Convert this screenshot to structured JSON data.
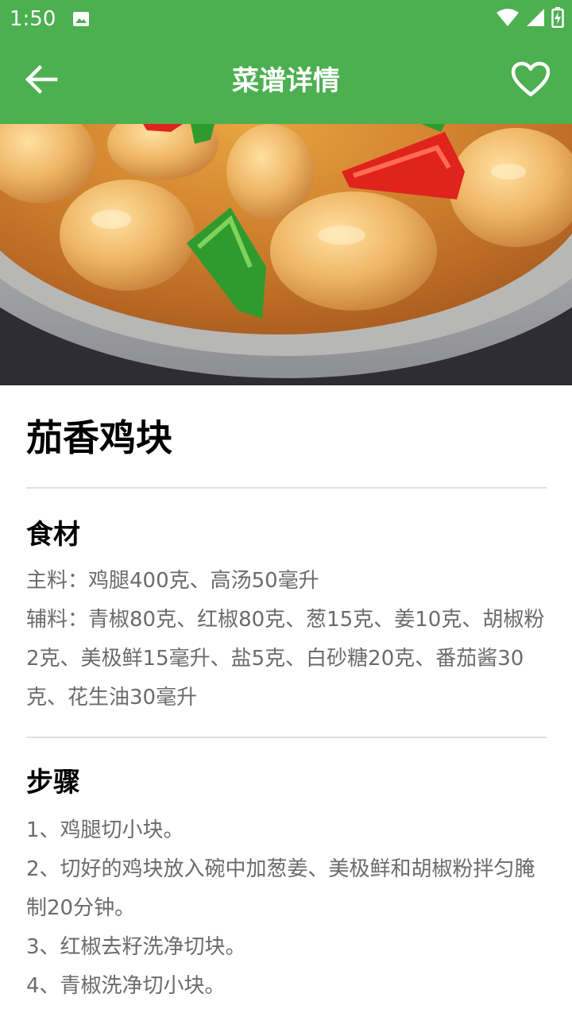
{
  "status_bar": {
    "time": "1:50",
    "icons": [
      "image-icon",
      "wifi-icon",
      "signal-icon",
      "battery-charging-icon"
    ]
  },
  "app_bar": {
    "title": "菜谱详情",
    "back_icon": "arrow-left-icon",
    "favorite_icon": "heart-outline-icon"
  },
  "hero": {
    "image": "dish-photo"
  },
  "recipe": {
    "name": "茄香鸡块",
    "ingredients_title": "食材",
    "ingredients": [
      "主料：鸡腿400克、高汤50毫升",
      "辅料：青椒80克、红椒80克、葱15克、姜10克、胡椒粉2克、美极鲜15毫升、盐5克、白砂糖20克、番茄酱30克、花生油30毫升"
    ],
    "steps_title": "步骤",
    "steps": [
      "1、鸡腿切小块。",
      "2、切好的鸡块放入碗中加葱姜、美极鲜和胡椒粉拌匀腌制20分钟。",
      "3、红椒去籽洗净切块。",
      "4、青椒洗净切小块。"
    ]
  },
  "colors": {
    "primary": "#4caf50",
    "text_primary": "#000000",
    "text_secondary": "#6b6b6b",
    "divider": "#e0e0e0"
  }
}
